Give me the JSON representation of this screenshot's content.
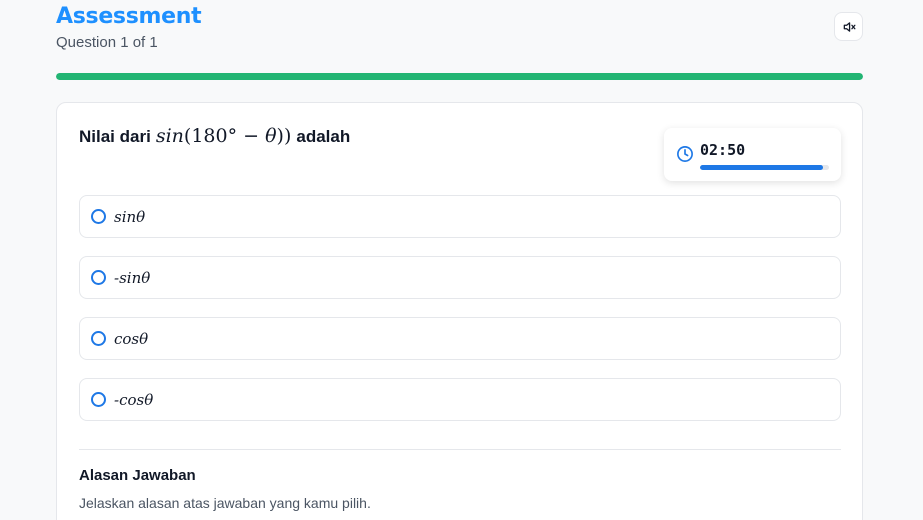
{
  "header": {
    "title": "Assessment",
    "subtitle": "Question 1 of 1",
    "mute_icon": "speaker-muted-icon"
  },
  "progress": {
    "value_percent": 100,
    "color": "#22b573"
  },
  "question": {
    "prefix": "Nilai dari",
    "math_func": "sin",
    "math_open": "(",
    "math_num": "180",
    "math_deg": "°",
    "math_minus": " − ",
    "math_theta": "θ",
    "math_close": "))",
    "suffix": "adalah"
  },
  "timer": {
    "icon": "clock-icon",
    "text": "02:50",
    "remaining_fraction": 0.95,
    "color": "#1e78e6"
  },
  "options": [
    {
      "label": "sinθ"
    },
    {
      "label": "-sinθ"
    },
    {
      "label": "cosθ"
    },
    {
      "label": "-cosθ"
    }
  ],
  "reason": {
    "title": "Alasan Jawaban",
    "help": "Jelaskan alasan atas jawaban yang kamu pilih."
  },
  "colors": {
    "accent": "#1e90ff",
    "radio": "#1e78e6"
  }
}
